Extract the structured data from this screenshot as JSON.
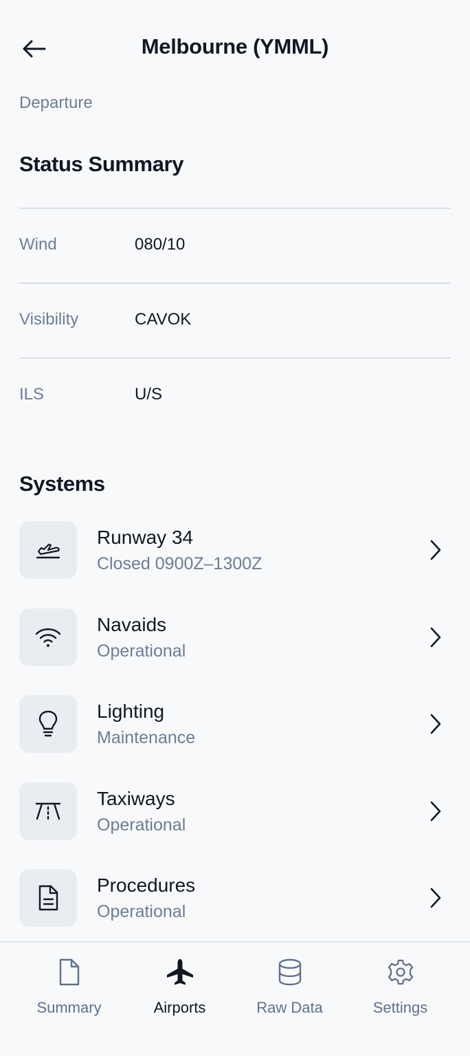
{
  "header": {
    "title": "Melbourne (YMML)",
    "back_icon": "arrow-left-icon"
  },
  "subtitle": "Departure",
  "status_summary": {
    "title": "Status Summary",
    "rows": [
      {
        "label": "Wind",
        "value": "080/10"
      },
      {
        "label": "Visibility",
        "value": "CAVOK"
      },
      {
        "label": "ILS",
        "value": "U/S"
      }
    ]
  },
  "systems": {
    "title": "Systems",
    "items": [
      {
        "name": "Runway 34",
        "status": "Closed 0900Z–1300Z",
        "icon": "plane-landing-icon"
      },
      {
        "name": "Navaids",
        "status": "Operational",
        "icon": "wifi-icon"
      },
      {
        "name": "Lighting",
        "status": "Maintenance",
        "icon": "lightbulb-icon"
      },
      {
        "name": "Taxiways",
        "status": "Operational",
        "icon": "road-icon"
      },
      {
        "name": "Procedures",
        "status": "Operational",
        "icon": "document-icon"
      }
    ]
  },
  "bottom_nav": {
    "items": [
      {
        "label": "Summary",
        "icon": "file-icon",
        "active": false
      },
      {
        "label": "Airports",
        "icon": "plane-icon",
        "active": true
      },
      {
        "label": "Raw Data",
        "icon": "database-icon",
        "active": false
      },
      {
        "label": "Settings",
        "icon": "gear-icon",
        "active": false
      }
    ]
  },
  "colors": {
    "background": "#f8f9fb",
    "text_primary": "#121722",
    "text_muted": "#6c7d95",
    "icon_box": "#e9ecf1",
    "divider": "#d9dde6"
  }
}
